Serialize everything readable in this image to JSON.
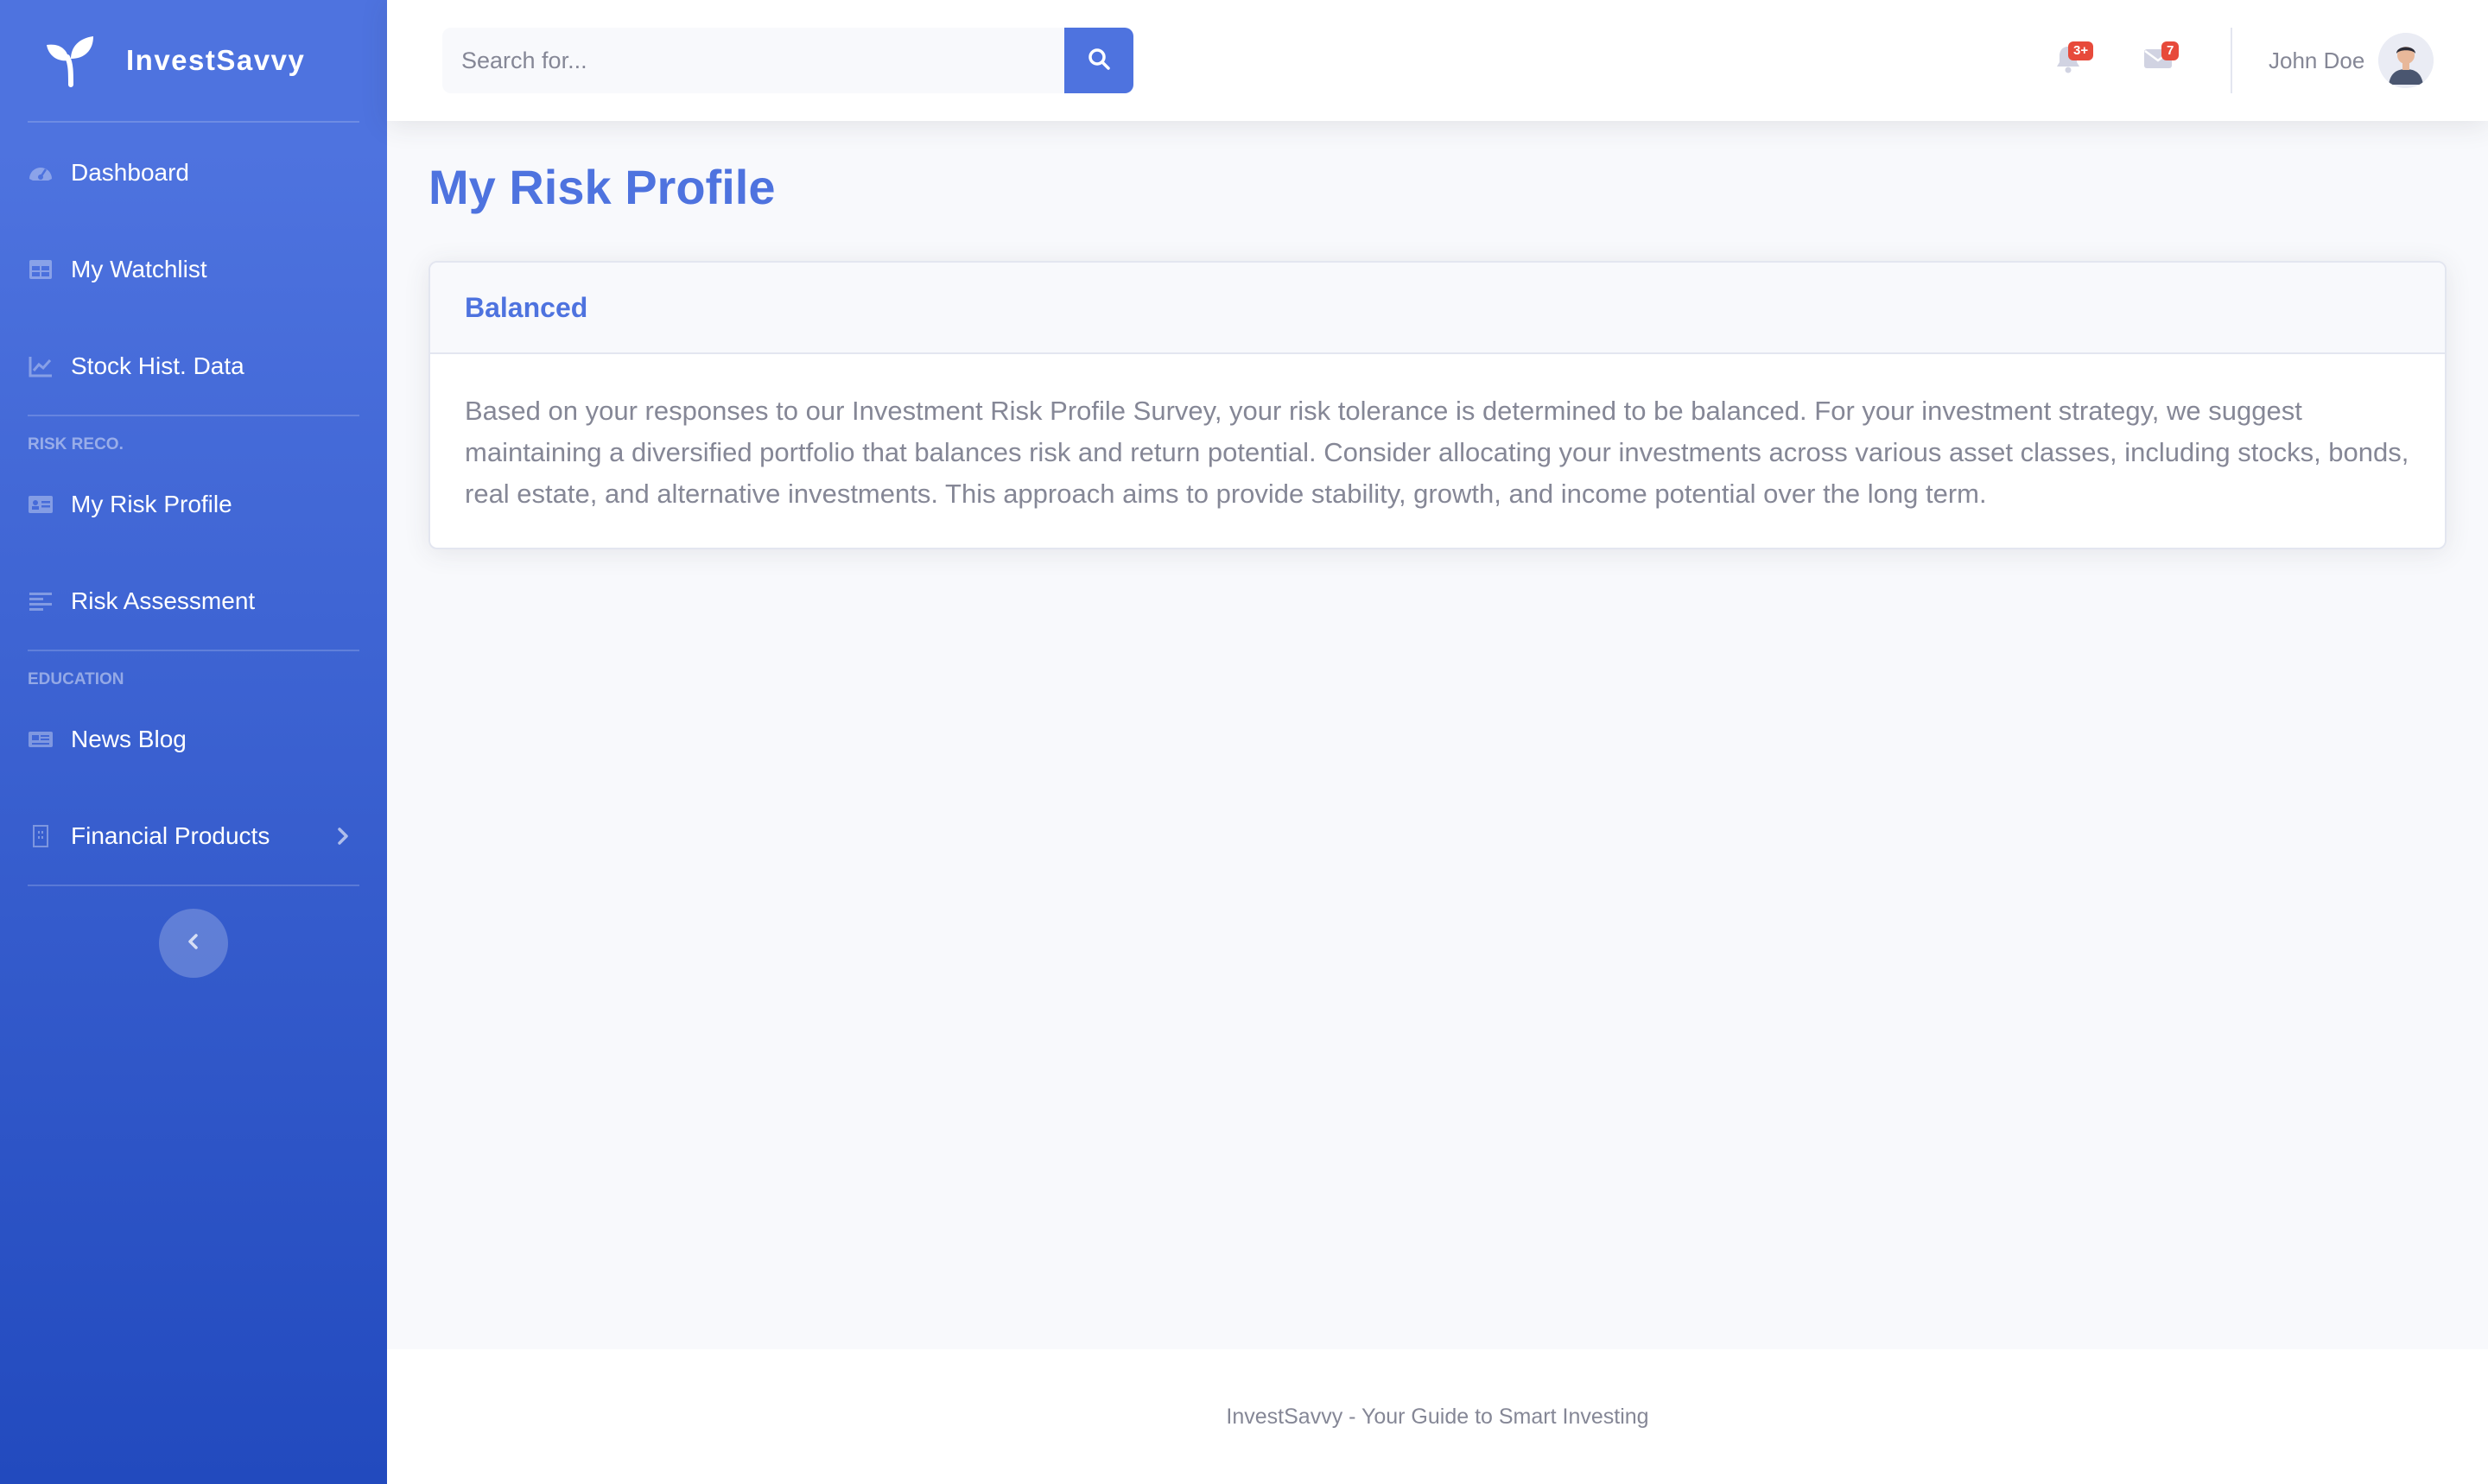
{
  "brand": {
    "name": "InvestSavvy",
    "logo_icon": "leaf-sprout-icon"
  },
  "sidebar": {
    "items": [
      {
        "label": "Dashboard",
        "icon": "tachometer-icon"
      },
      {
        "label": "My Watchlist",
        "icon": "table-icon"
      },
      {
        "label": "Stock Hist. Data",
        "icon": "chart-line-icon"
      }
    ],
    "section_risk": "RISK RECO.",
    "risk_items": [
      {
        "label": "My Risk Profile",
        "icon": "id-card-icon"
      },
      {
        "label": "Risk Assessment",
        "icon": "align-left-icon"
      }
    ],
    "section_education": "EDUCATION",
    "education_items": [
      {
        "label": "News Blog",
        "icon": "newspaper-icon"
      },
      {
        "label": "Financial Products",
        "icon": "building-icon"
      }
    ]
  },
  "topbar": {
    "search_placeholder": "Search for...",
    "alerts_badge": "3+",
    "messages_badge": "7",
    "user_name": "John Doe"
  },
  "main": {
    "page_title": "My Risk Profile",
    "card": {
      "title": "Balanced",
      "body": "Based on your responses to our Investment Risk Profile Survey, your risk tolerance is determined to be balanced. For your investment strategy, we suggest maintaining a diversified portfolio that balances risk and return potential. Consider allocating your investments across various asset classes, including stocks, bonds, real estate, and alternative investments. This approach aims to provide stability, growth, and income potential over the long term."
    }
  },
  "footer": {
    "text": "InvestSavvy - Your Guide to Smart Investing"
  },
  "colors": {
    "primary": "#4e73df",
    "primary_dark": "#224abe",
    "badge": "#e74a3b",
    "text_muted": "#858796"
  }
}
